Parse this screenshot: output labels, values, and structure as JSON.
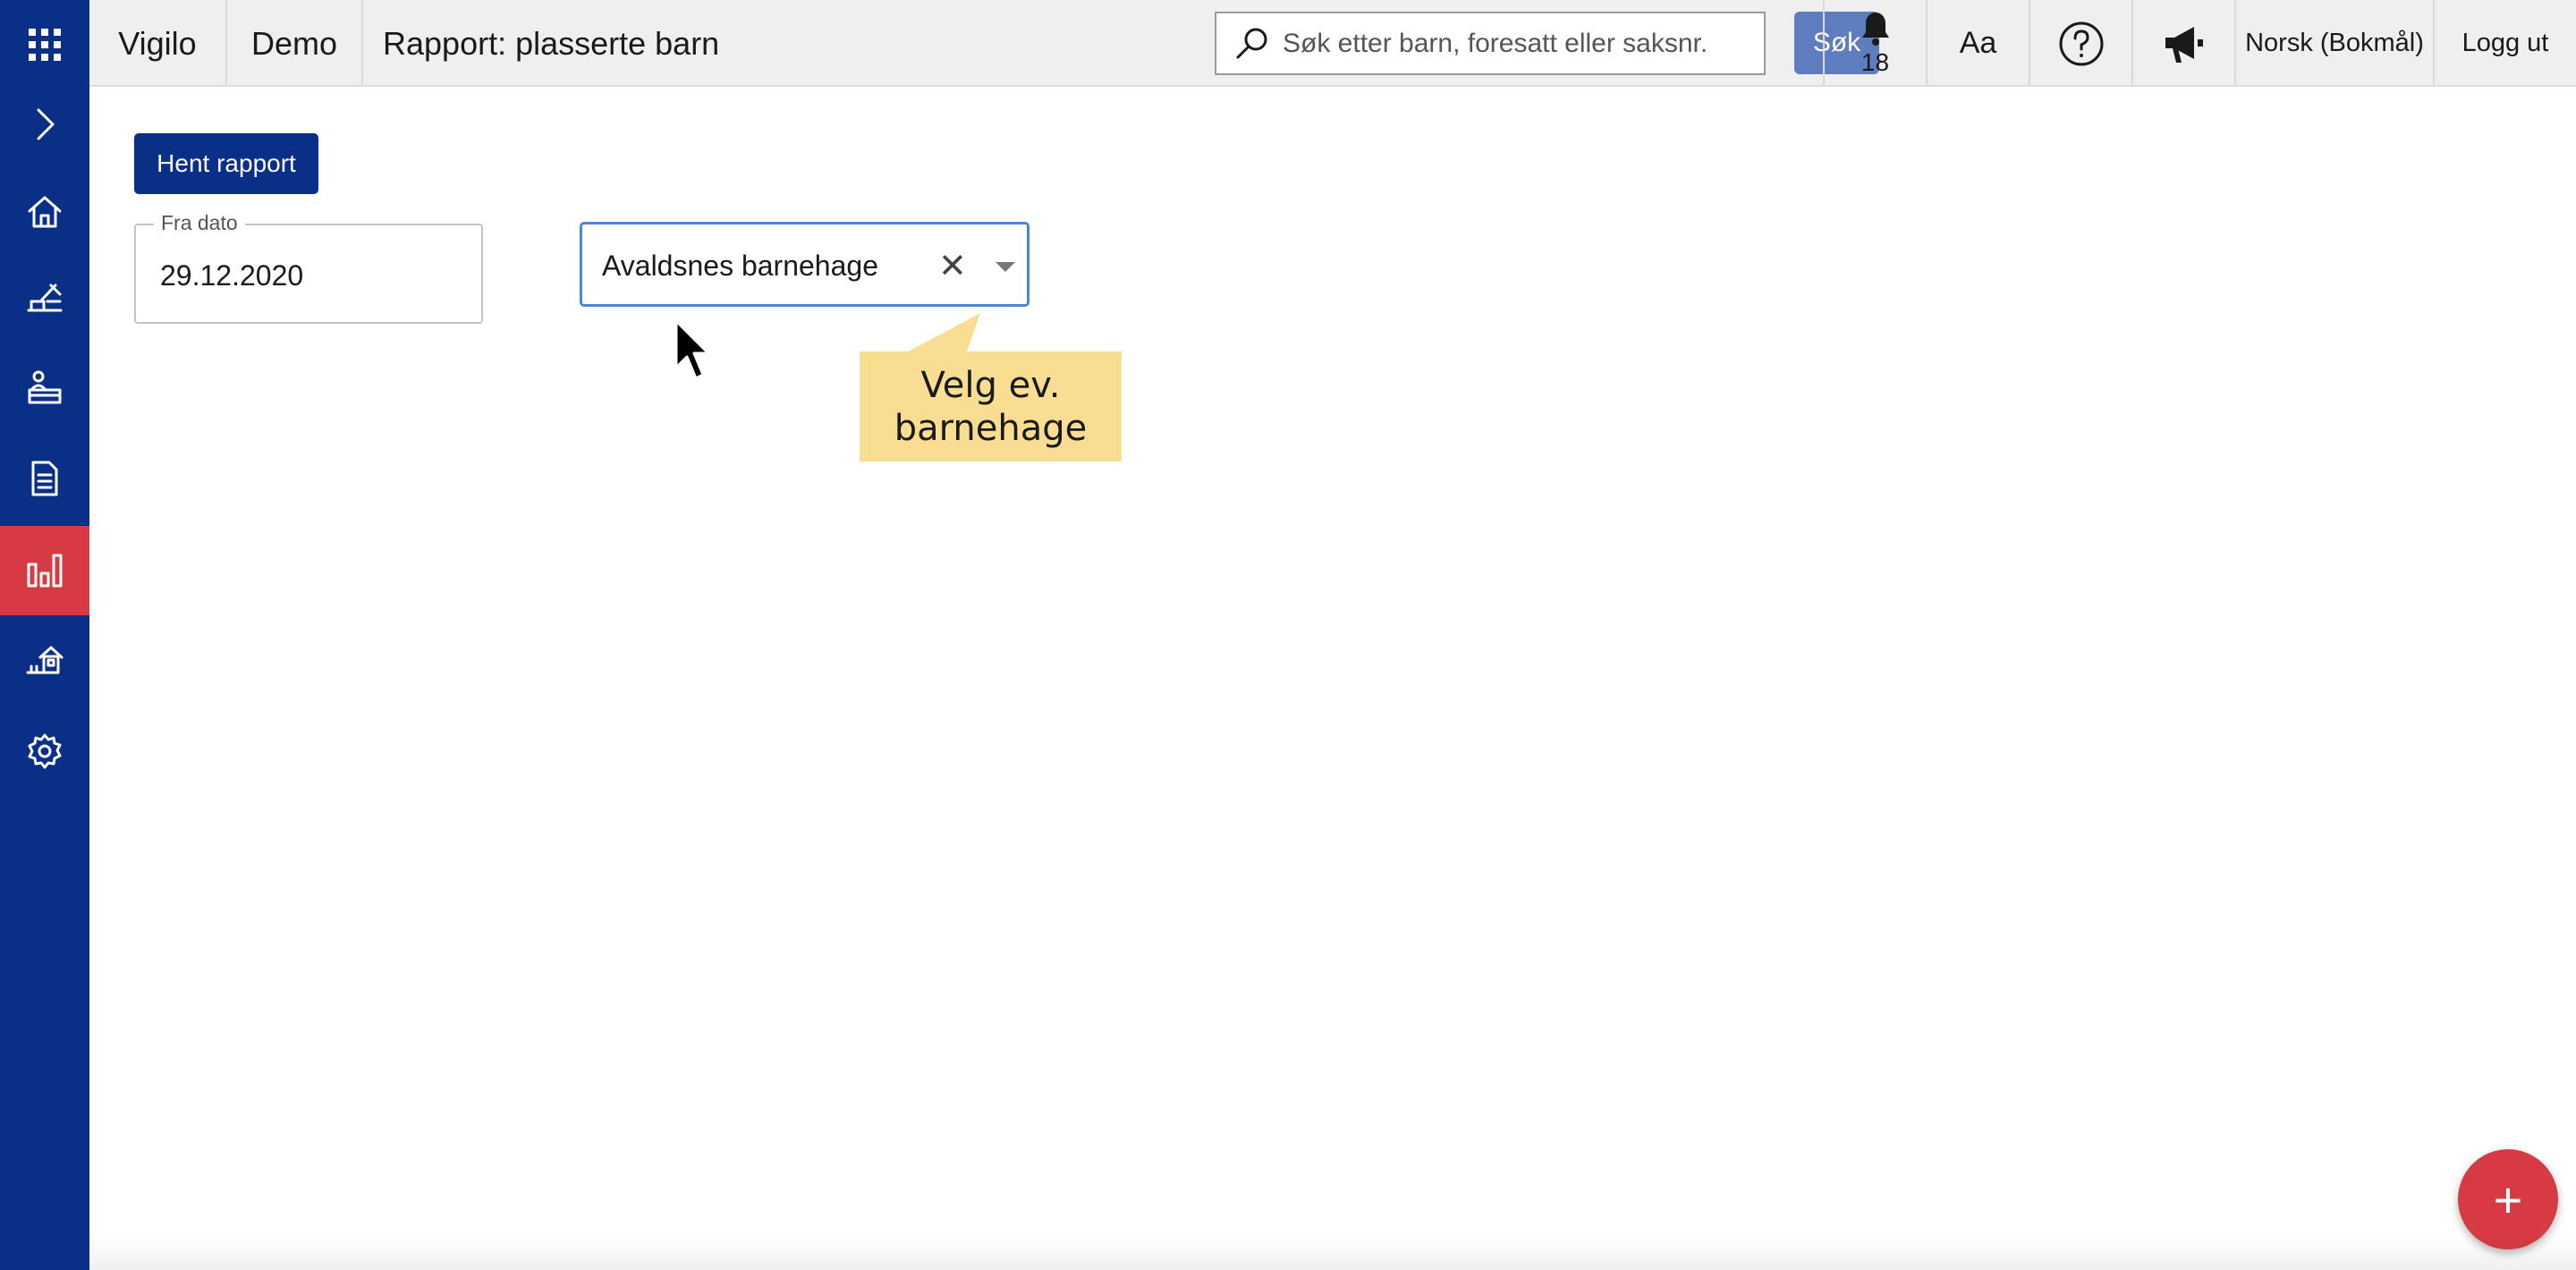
{
  "header": {
    "brand": "Vigilo",
    "demo": "Demo",
    "page_title": "Rapport: plasserte barn",
    "search_placeholder": "Søk etter barn, foresatt eller saksnr.",
    "search_button": "Søk",
    "notifications_count": "18",
    "font_size_label": "Aa",
    "language": "Norsk (Bokmål)",
    "logout": "Logg ut"
  },
  "sidebar": {
    "icons": [
      "apps-grid-icon",
      "chevron-right-icon",
      "home-icon",
      "sandbox-icon",
      "classroom-icon",
      "document-icon",
      "bar-chart-icon",
      "house-icon",
      "gear-icon"
    ],
    "active_item": "bar-chart-icon"
  },
  "main": {
    "fetch_button": "Hent rapport",
    "from_date_label": "Fra dato",
    "from_date_value": "29.12.2020",
    "kindergarten_value": "Avaldsnes barnehage",
    "clear_symbol": "✕",
    "tooltip": "Velg ev. barnehage",
    "fab_symbol": "+"
  },
  "colors": {
    "sidebar": "#0a2f86",
    "active": "#d63a42",
    "button": "#0a2f86",
    "search_button": "#5d7dbf",
    "tooltip": "#f9dd92"
  }
}
